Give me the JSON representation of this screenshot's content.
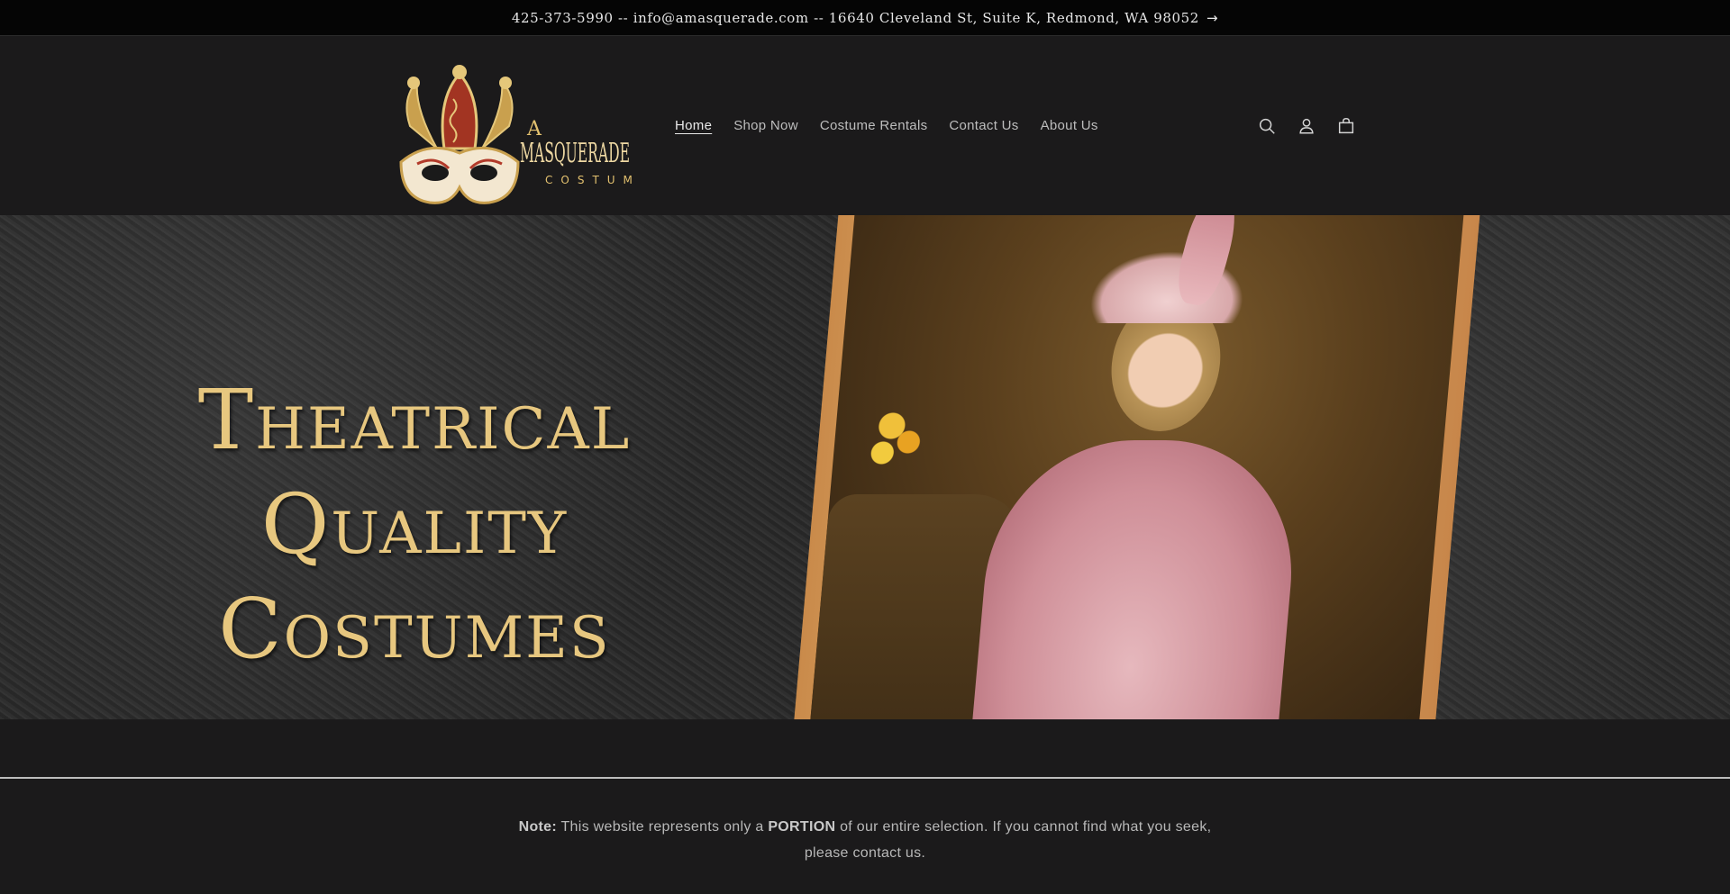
{
  "announcement": {
    "text": "425-373-5990 -- info@amasquerade.com -- 16640 Cleveland St, Suite K, Redmond, WA 98052",
    "arrow": "→"
  },
  "logo": {
    "line1": "A",
    "line2": "MASQUERADE",
    "line3": "COSTUME",
    "colors": {
      "gold": "#e3c16f",
      "red": "#b23a2a"
    }
  },
  "nav": {
    "items": [
      {
        "label": "Home",
        "active": true
      },
      {
        "label": "Shop Now",
        "active": false
      },
      {
        "label": "Costume Rentals",
        "active": false
      },
      {
        "label": "Contact Us",
        "active": false
      },
      {
        "label": "About Us",
        "active": false
      }
    ]
  },
  "header_icons": [
    "search-icon",
    "account-icon",
    "cart-icon"
  ],
  "hero": {
    "line1": "Theatrical",
    "line2": "Quality",
    "line3": "Costumes",
    "text_color": "#e7c77f"
  },
  "note": {
    "label": "Note:",
    "text_before": "This website represents only a",
    "emphasis": "PORTION",
    "text_after": "of our entire selection. If you cannot find what you seek, please contact us."
  },
  "colors": {
    "page_bg": "#1b1a1b",
    "announcement_bg": "#050505"
  }
}
